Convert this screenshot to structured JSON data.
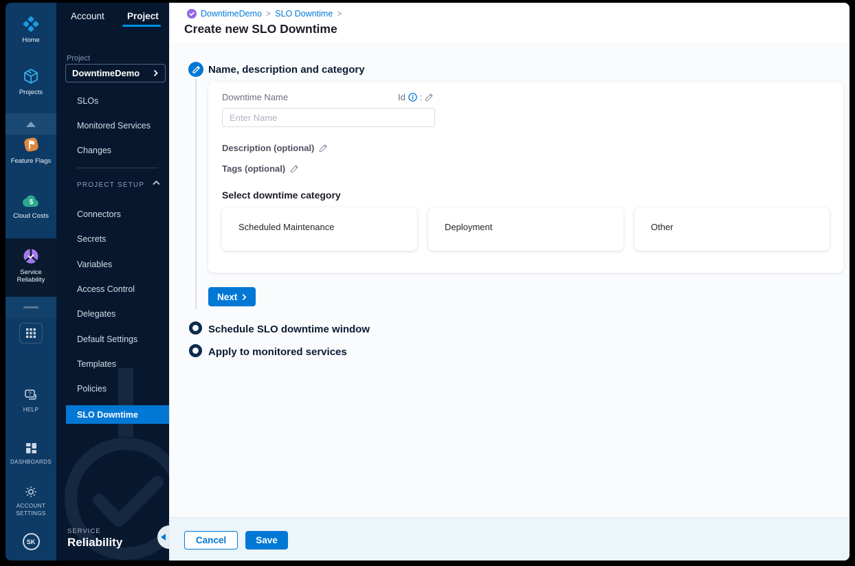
{
  "colors": {
    "accent": "#0278d5",
    "tab_underline": "#0092e4",
    "rail_bg": "#0d3b66",
    "sidebar_bg": "#07182e"
  },
  "rail": {
    "modules": [
      {
        "label": "Home"
      },
      {
        "label": "Projects"
      },
      {
        "label": "Feature Flags"
      },
      {
        "label": "Cloud Costs"
      },
      {
        "label": "Service Reliability"
      }
    ],
    "bottom": [
      {
        "label": "HELP"
      },
      {
        "label": "DASHBOARDS"
      },
      {
        "label": "ACCOUNT SETTINGS"
      }
    ],
    "avatar": "SK"
  },
  "sidebar": {
    "tabs": {
      "account": "Account",
      "project": "Project"
    },
    "project_label": "Project",
    "project_selector": "DowntimeDemo",
    "items": [
      "SLOs",
      "Monitored Services",
      "Changes"
    ],
    "setup_label": "PROJECT SETUP",
    "setup_items": [
      "Connectors",
      "Secrets",
      "Variables",
      "Access Control",
      "Delegates",
      "Default Settings",
      "Templates",
      "Policies"
    ],
    "active_item": "SLO Downtime",
    "footer": {
      "kicker": "SERVICE",
      "title": "Reliability"
    }
  },
  "main": {
    "breadcrumb": {
      "project": "DowntimeDemo",
      "section": "SLO Downtime",
      "sep": ">"
    },
    "title": "Create new SLO Downtime",
    "steps": {
      "step1": "Name, description and category",
      "step2": "Schedule SLO downtime window",
      "step3": "Apply to monitored services"
    },
    "form": {
      "name_label": "Downtime Name",
      "id_label": "Id",
      "id_colon": ":",
      "name_placeholder": "Enter Name",
      "description_label": "Description (optional)",
      "tags_label": "Tags (optional)",
      "category_label": "Select downtime category",
      "categories": [
        "Scheduled Maintenance",
        "Deployment",
        "Other"
      ]
    },
    "next_button": "Next",
    "footer": {
      "cancel": "Cancel",
      "save": "Save"
    }
  }
}
